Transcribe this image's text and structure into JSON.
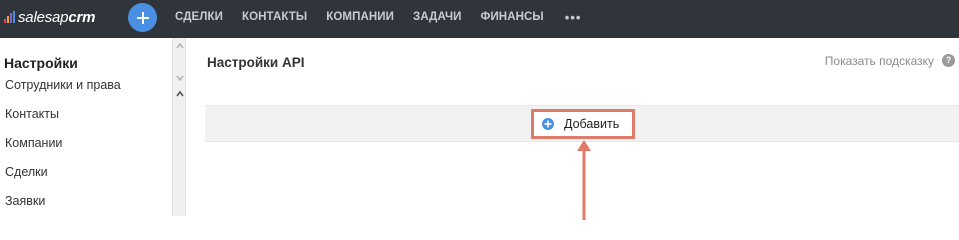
{
  "app": {
    "logo_text_regular": "salesap",
    "logo_text_bold": "crm",
    "logo_bar_colors": [
      "#e4405f",
      "#f5a623",
      "#7b68ee",
      "#4a90e2"
    ],
    "accent_color": "#4a90e2"
  },
  "topbar": {
    "add_icon": "plus-icon",
    "nav": [
      {
        "label": "СДЕЛКИ"
      },
      {
        "label": "КОНТАКТЫ"
      },
      {
        "label": "КОМПАНИИ"
      },
      {
        "label": "ЗАДАЧИ"
      },
      {
        "label": "ФИНАНСЫ"
      }
    ],
    "more_label": "•••"
  },
  "sidebar": {
    "title": "Настройки",
    "clipped_item": "Сотрудники и права",
    "items": [
      {
        "label": "Контакты"
      },
      {
        "label": "Компании"
      },
      {
        "label": "Сделки"
      },
      {
        "label": "Заявки"
      }
    ]
  },
  "content": {
    "title": "Настройки API",
    "hint_label": "Показать подсказку",
    "hint_icon": "?",
    "add_button_label": "Добавить",
    "highlight_color": "#e07a6a"
  }
}
